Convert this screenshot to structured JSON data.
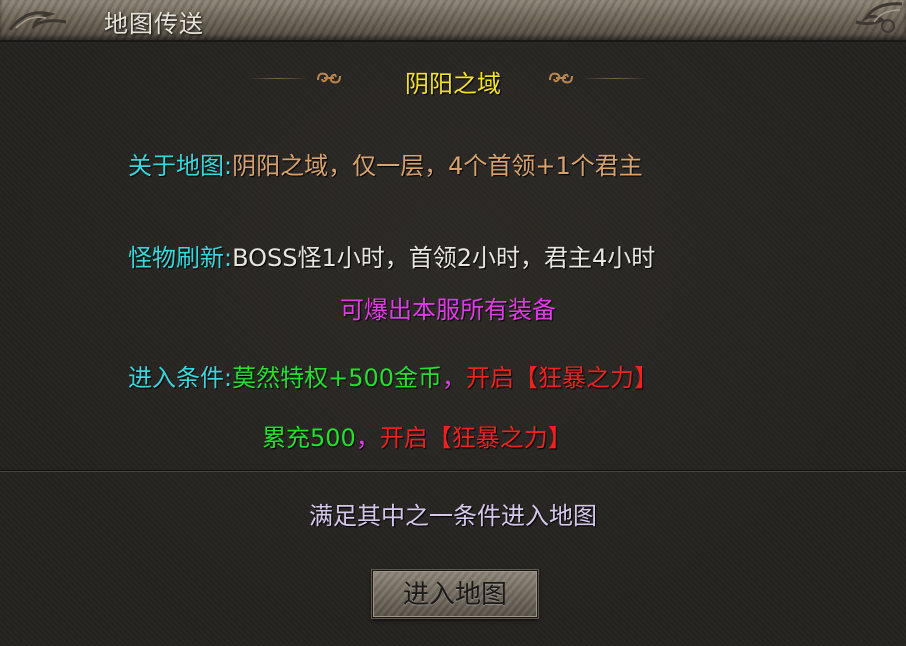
{
  "window": {
    "title": "地图传送"
  },
  "map": {
    "name": "阴阳之域"
  },
  "info": {
    "about_label": "关于地图:",
    "about_value": "阴阳之域，仅一层，4个首领+1个君主",
    "refresh_label": "怪物刷新:",
    "refresh_value": "BOSS怪1小时，首领2小时，君主4小时",
    "drop_note": "可爆出本服所有装备",
    "condition_label": "进入条件:",
    "condition1_req": "莫然特权+500金币",
    "condition1_sep": "，",
    "condition1_unlock": "开启【狂暴之力】",
    "condition2_req": "累充500",
    "condition2_sep": "，",
    "condition2_unlock": "开启【狂暴之力】"
  },
  "footer": {
    "hint": "满足其中之一条件进入地图",
    "enter_button": "进入地图"
  },
  "colors": {
    "label": "#35d8dc",
    "map_name": "#f2e22a",
    "about_value": "#d9a36c",
    "refresh_value": "#e9e6df",
    "drop_note": "#e23ae9",
    "requirement": "#22e02b",
    "unlock": "#f2211f",
    "hint": "#d6c8ec"
  },
  "icons": {
    "header_left_ornament": "scroll-ornament-icon",
    "header_right_ornament": "scroll-ornament-icon",
    "titlebar_left_ornament": "swirl-ornament-icon",
    "titlebar_right_ornament": "swirl-ornament-icon"
  }
}
